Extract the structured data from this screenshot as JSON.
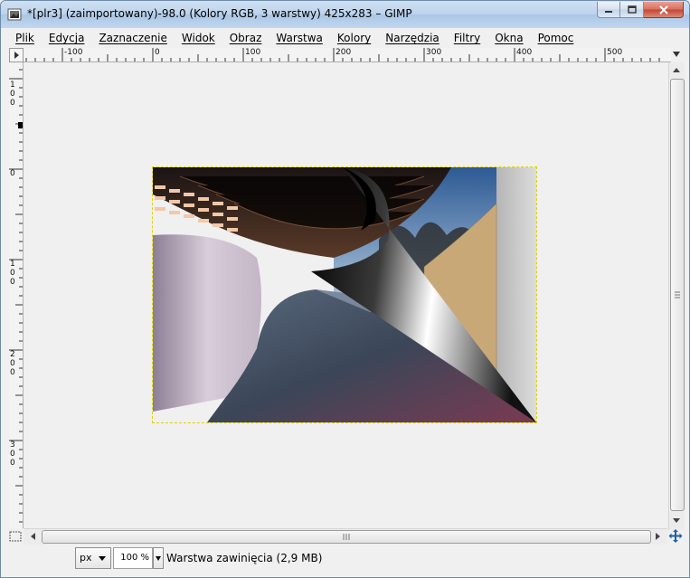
{
  "window": {
    "title": "*[plr3] (zaimportowany)-98.0 (Kolory RGB, 3 warstwy) 425x283 – GIMP"
  },
  "menu": [
    {
      "label": "Plik"
    },
    {
      "label": "Edycja"
    },
    {
      "label": "Zaznaczenie"
    },
    {
      "label": "Widok"
    },
    {
      "label": "Obraz"
    },
    {
      "label": "Warstwa"
    },
    {
      "label": "Kolory"
    },
    {
      "label": "Narzędzia"
    },
    {
      "label": "Filtry"
    },
    {
      "label": "Okna"
    },
    {
      "label": "Pomoc"
    }
  ],
  "rulers": {
    "horizontal_labels": [
      "-100",
      "0",
      "100",
      "200",
      "300",
      "400",
      "500"
    ],
    "vertical_labels": [
      "100",
      "0",
      "100",
      "200",
      "300"
    ]
  },
  "status": {
    "unit": "px",
    "zoom": "100 %",
    "layer_info": "Warstwa zawinięcia (2,9 MB)"
  },
  "icons": {
    "app": "gimp-icon",
    "minimize": "minimize-icon",
    "maximize": "maximize-icon",
    "close": "close-icon",
    "navigate": "navigate-icon",
    "quick_mask": "quick-mask-icon"
  }
}
